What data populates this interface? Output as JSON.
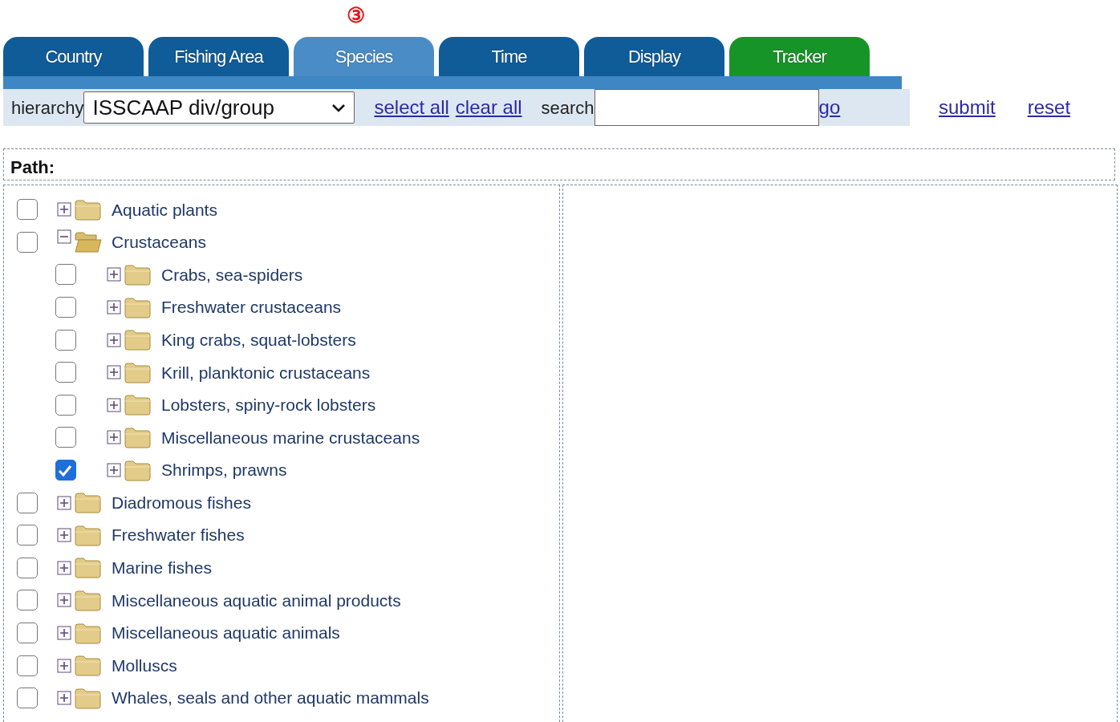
{
  "step_marker": "③",
  "tabs": [
    {
      "label": "Country",
      "selected": false,
      "kind": "section"
    },
    {
      "label": "Fishing Area",
      "selected": false,
      "kind": "section"
    },
    {
      "label": "Species",
      "selected": true,
      "kind": "section"
    },
    {
      "label": "Time",
      "selected": false,
      "kind": "section"
    },
    {
      "label": "Display",
      "selected": false,
      "kind": "section"
    },
    {
      "label": "Tracker",
      "selected": false,
      "kind": "tracker"
    }
  ],
  "toolbar": {
    "hierarchy_label": "hierarchy",
    "hierarchy_value": "ISSCAAP div/group",
    "select_all": "select all",
    "clear_all": "clear all",
    "search_label": "search",
    "go": "go",
    "submit": "submit",
    "reset": "reset"
  },
  "path_label": "Path:",
  "tree": [
    {
      "label": "Aquatic plants",
      "checked": false,
      "expanded": false
    },
    {
      "label": "Crustaceans",
      "checked": false,
      "expanded": true,
      "children": [
        {
          "label": "Crabs, sea-spiders",
          "checked": false,
          "expanded": false
        },
        {
          "label": "Freshwater crustaceans",
          "checked": false,
          "expanded": false
        },
        {
          "label": "King crabs, squat-lobsters",
          "checked": false,
          "expanded": false
        },
        {
          "label": "Krill, planktonic crustaceans",
          "checked": false,
          "expanded": false
        },
        {
          "label": "Lobsters, spiny-rock lobsters",
          "checked": false,
          "expanded": false
        },
        {
          "label": "Miscellaneous marine crustaceans",
          "checked": false,
          "expanded": false
        },
        {
          "label": "Shrimps, prawns",
          "checked": true,
          "expanded": false
        }
      ]
    },
    {
      "label": "Diadromous fishes",
      "checked": false,
      "expanded": false
    },
    {
      "label": "Freshwater fishes",
      "checked": false,
      "expanded": false
    },
    {
      "label": "Marine fishes",
      "checked": false,
      "expanded": false
    },
    {
      "label": "Miscellaneous aquatic animal products",
      "checked": false,
      "expanded": false
    },
    {
      "label": "Miscellaneous aquatic animals",
      "checked": false,
      "expanded": false
    },
    {
      "label": "Molluscs",
      "checked": false,
      "expanded": false
    },
    {
      "label": "Whales, seals and other aquatic mammals",
      "checked": false,
      "expanded": false
    }
  ]
}
